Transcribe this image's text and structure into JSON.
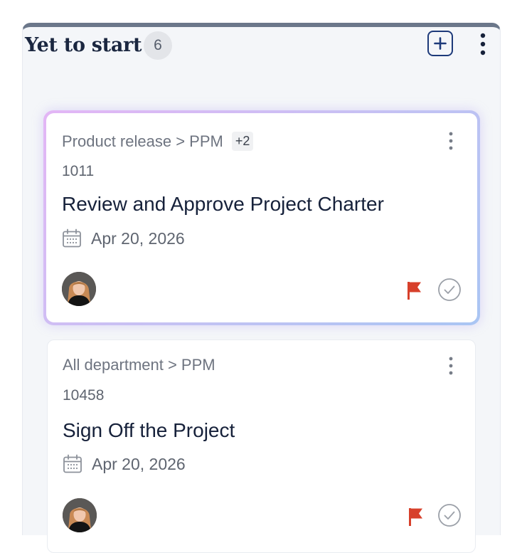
{
  "column": {
    "title": "Yet to start",
    "count": "6",
    "add_icon": "plus-square-icon",
    "more_icon": "more-vertical-icon",
    "accent_color": "#6b778a"
  },
  "cards": [
    {
      "breadcrumb": "Product release > PPM",
      "extra_tags": "+2",
      "id": "1011",
      "title": "Review and Approve Project Charter",
      "date": "Apr 20, 2026",
      "selected": true,
      "flag_color": "#d7402b",
      "status_icon": "check-circle-icon"
    },
    {
      "breadcrumb": "All department > PPM",
      "id": "10458",
      "title": "Sign Off the Project",
      "date": "Apr 20, 2026",
      "selected": false,
      "flag_color": "#d7402b",
      "status_icon": "check-circle-icon"
    }
  ]
}
